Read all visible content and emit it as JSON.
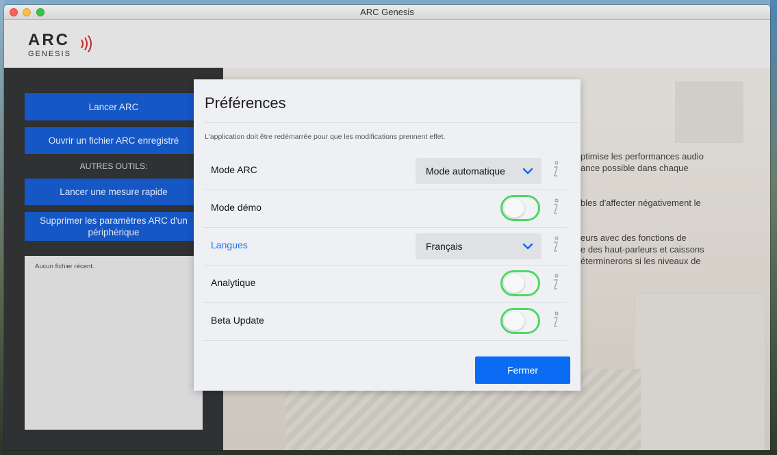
{
  "window": {
    "title": "ARC Genesis"
  },
  "logo": {
    "brand": "ARC",
    "sub": "GENESIS"
  },
  "sidebar": {
    "buttons": [
      {
        "label": "Lancer ARC"
      },
      {
        "label": "Ouvrir un fichier ARC enregistré"
      },
      {
        "label": "Lancer une mesure rapide"
      },
      {
        "label": "Supprimer les paramètres ARC d'un périphérique"
      }
    ],
    "tools_heading": "AUTRES OUTILS:",
    "recent_empty": "Aucun fichier récent."
  },
  "background_text": {
    "p1_line1": "ptimise les performances audio",
    "p1_line2": "ance possible dans chaque",
    "p2_line1": "bles d'affecter négativement le",
    "p3_line1": "eurs avec des fonctions de",
    "p3_line2": "e des haut-parleurs et caissons",
    "p3_line3": "éterminerons si les niveaux de"
  },
  "preferences": {
    "title": "Préférences",
    "note": "L'application doit être redémarrée pour que les modifications prennent effet.",
    "rows": [
      {
        "label": "Mode ARC",
        "control": "select",
        "value": "Mode automatique"
      },
      {
        "label": "Mode démo",
        "control": "toggle",
        "on": false
      },
      {
        "label": "Langues",
        "control": "select",
        "value": "Français"
      },
      {
        "label": "Analytique",
        "control": "toggle",
        "on": false
      },
      {
        "label": "Beta Update",
        "control": "toggle",
        "on": false
      }
    ],
    "close_label": "Fermer"
  },
  "colors": {
    "sidebar_button": "#1657c6",
    "primary_button": "#0a6cf5",
    "toggle_border": "#4cd964",
    "link": "#1a73e8"
  }
}
